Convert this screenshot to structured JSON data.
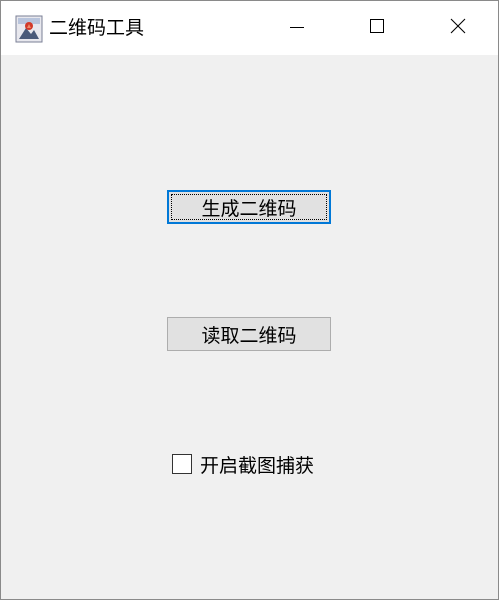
{
  "window": {
    "title": "二维码工具",
    "icon": "app-icon",
    "controls": [
      "minimize-icon",
      "maximize-icon",
      "close-icon"
    ]
  },
  "main": {
    "generate_button": "生成二维码",
    "read_button": "读取二维码",
    "capture_checkbox": {
      "label": "开启截图捕获",
      "checked": false
    }
  },
  "colors": {
    "client_bg": "#f0f0f0",
    "button_bg": "#e1e1e1",
    "focus_border": "#0078d7"
  }
}
